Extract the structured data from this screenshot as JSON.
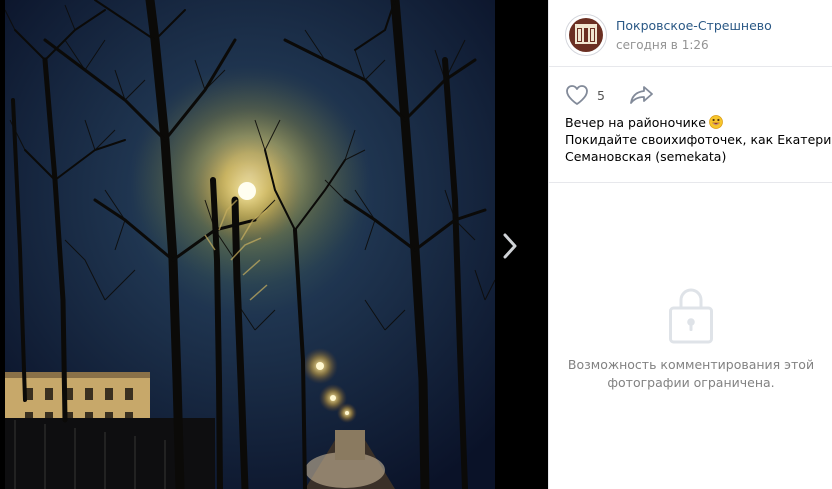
{
  "post": {
    "author": "Покровское-Стрешнево",
    "time": "сегодня в 1:26",
    "likes": "5",
    "caption_line1": "Вечер на районочике",
    "caption_line2": "Покидайте своихифоточек, как Екатерина",
    "caption_line3": "Семановская (semekata)"
  },
  "comments": {
    "disabled_line1": "Возможность комментирования этой",
    "disabled_line2": "фотографии ограничена."
  },
  "icons": {
    "like": "heart-icon",
    "share": "share-arrow-icon",
    "next": "chevron-right-icon",
    "lock": "lock-icon",
    "emoji": "grinning-face-icon"
  },
  "colors": {
    "link": "#2a5885",
    "muted": "#939393",
    "icon": "#828a99"
  }
}
